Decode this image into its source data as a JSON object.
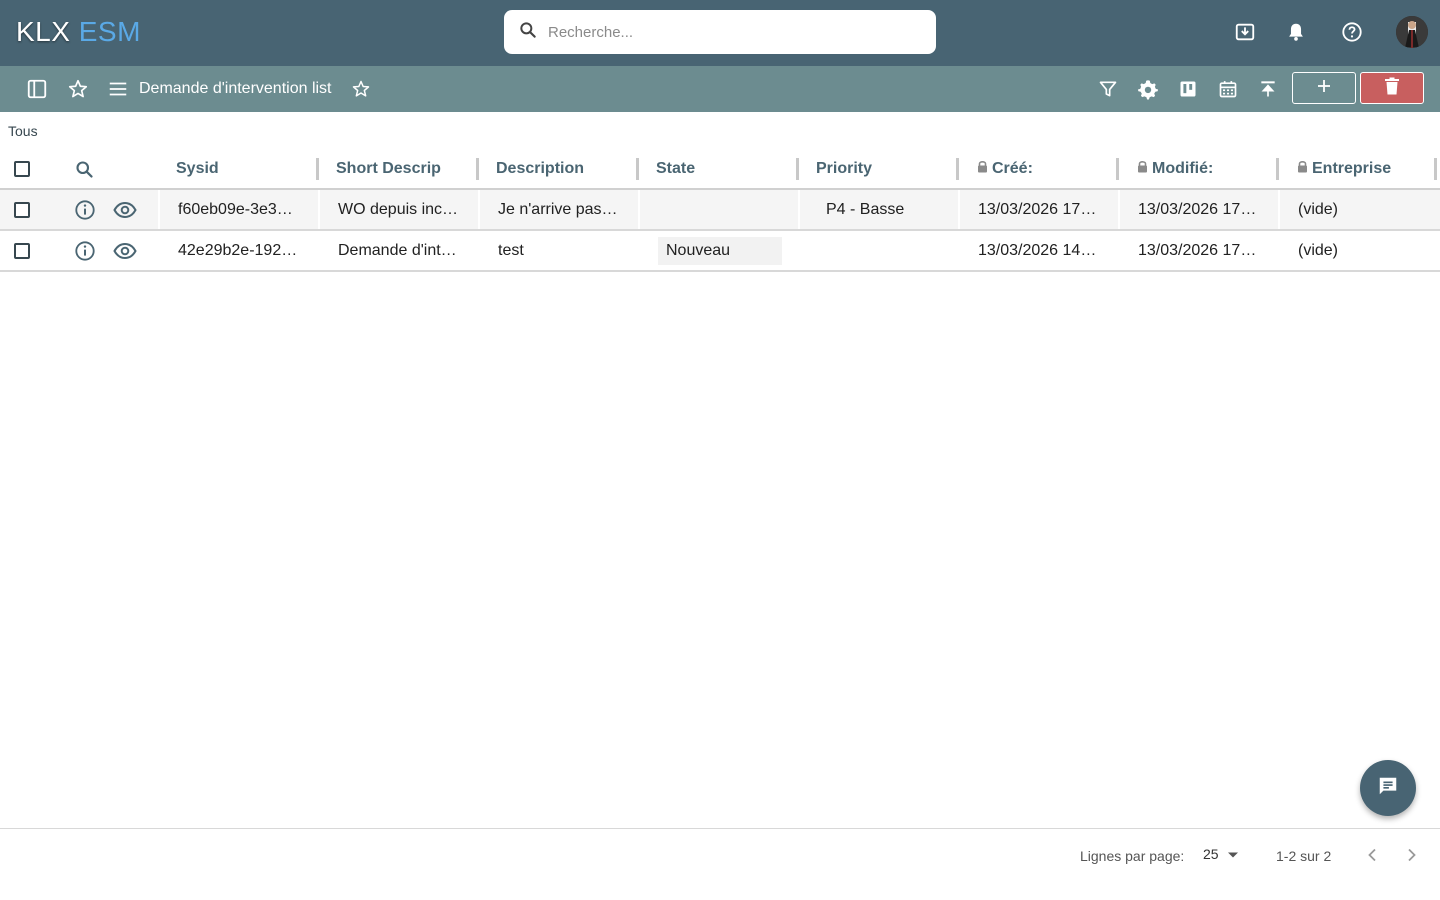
{
  "app": {
    "logo_part1": "KLX",
    "logo_part2": "ESM",
    "search_placeholder": "Recherche..."
  },
  "toolbar": {
    "title": "Demande d'intervention list"
  },
  "filter": {
    "label": "Tous"
  },
  "table": {
    "columns": [
      {
        "label": "Sysid",
        "locked": false
      },
      {
        "label": "Short Descrip",
        "locked": false
      },
      {
        "label": "Description",
        "locked": false
      },
      {
        "label": "State",
        "locked": false
      },
      {
        "label": "Priority",
        "locked": false
      },
      {
        "label": "Créé:",
        "locked": true
      },
      {
        "label": "Modifié:",
        "locked": true
      },
      {
        "label": "Entreprise",
        "locked": true
      }
    ],
    "rows": [
      {
        "sysid": "f60eb09e-3e3…",
        "short_description": "WO depuis inc…",
        "description": "Je n'arrive pas…",
        "state": "",
        "priority": "P4 - Basse",
        "created": "13/03/2026 17…",
        "modified": "13/03/2026 17…",
        "company": "(vide)"
      },
      {
        "sysid": "42e29b2e-192…",
        "short_description": "Demande d'int…",
        "description": "test",
        "state": "Nouveau",
        "priority": "",
        "created": "13/03/2026 14…",
        "modified": "13/03/2026 17…",
        "company": "(vide)"
      }
    ]
  },
  "footer": {
    "rows_per_page_label": "Lignes par page:",
    "rows_per_page_value": "25",
    "range": "1-2 sur 2"
  },
  "colors": {
    "appbar": "#486473",
    "toolbar": "#6c8c90",
    "delete": "#c85f5f",
    "accent": "#5aa9e6"
  }
}
